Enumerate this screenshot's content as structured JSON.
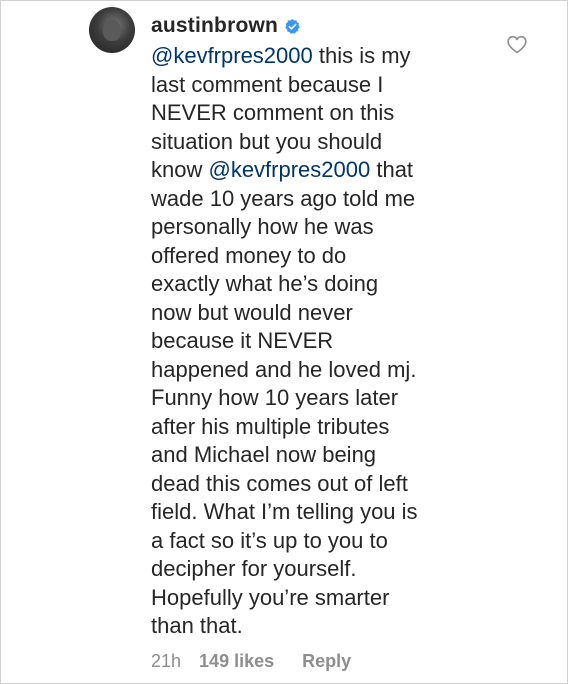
{
  "comment": {
    "username": "austinbrown",
    "verified": true,
    "lines": [
      [
        {
          "t": "@kevfrpres2000",
          "mention": true
        },
        {
          "t": " this is my"
        }
      ],
      [
        {
          "t": "last comment because I"
        }
      ],
      [
        {
          "t": "NEVER comment on this"
        }
      ],
      [
        {
          "t": "situation but you should"
        }
      ],
      [
        {
          "t": "know "
        },
        {
          "t": "@kevfrpres2000",
          "mention": true
        },
        {
          "t": " that"
        }
      ],
      [
        {
          "t": "wade 10 years ago told me"
        }
      ],
      [
        {
          "t": "personally how he was"
        }
      ],
      [
        {
          "t": "offered money to do"
        }
      ],
      [
        {
          "t": "exactly what he’s doing"
        }
      ],
      [
        {
          "t": "now but would never"
        }
      ],
      [
        {
          "t": "because it NEVER"
        }
      ],
      [
        {
          "t": "happened and he loved mj."
        }
      ],
      [
        {
          "t": "Funny how 10 years later"
        }
      ],
      [
        {
          "t": "after his multiple tributes"
        }
      ],
      [
        {
          "t": "and Michael now being"
        }
      ],
      [
        {
          "t": "dead this comes out of left"
        }
      ],
      [
        {
          "t": "field. What I’m telling you is"
        }
      ],
      [
        {
          "t": "a fact so it’s up to you to"
        }
      ],
      [
        {
          "t": "decipher for yourself."
        }
      ],
      [
        {
          "t": "Hopefully you’re smarter"
        }
      ],
      [
        {
          "t": "than that."
        }
      ]
    ],
    "time": "21h",
    "likes": "149 likes",
    "reply_label": "Reply"
  },
  "icons": {
    "verified": "verified-badge-icon",
    "like": "heart-outline-icon",
    "avatar": "profile-avatar"
  },
  "colors": {
    "text": "#262626",
    "mention": "#003569",
    "meta": "#8e8e8e",
    "verified": "#3897f0"
  }
}
